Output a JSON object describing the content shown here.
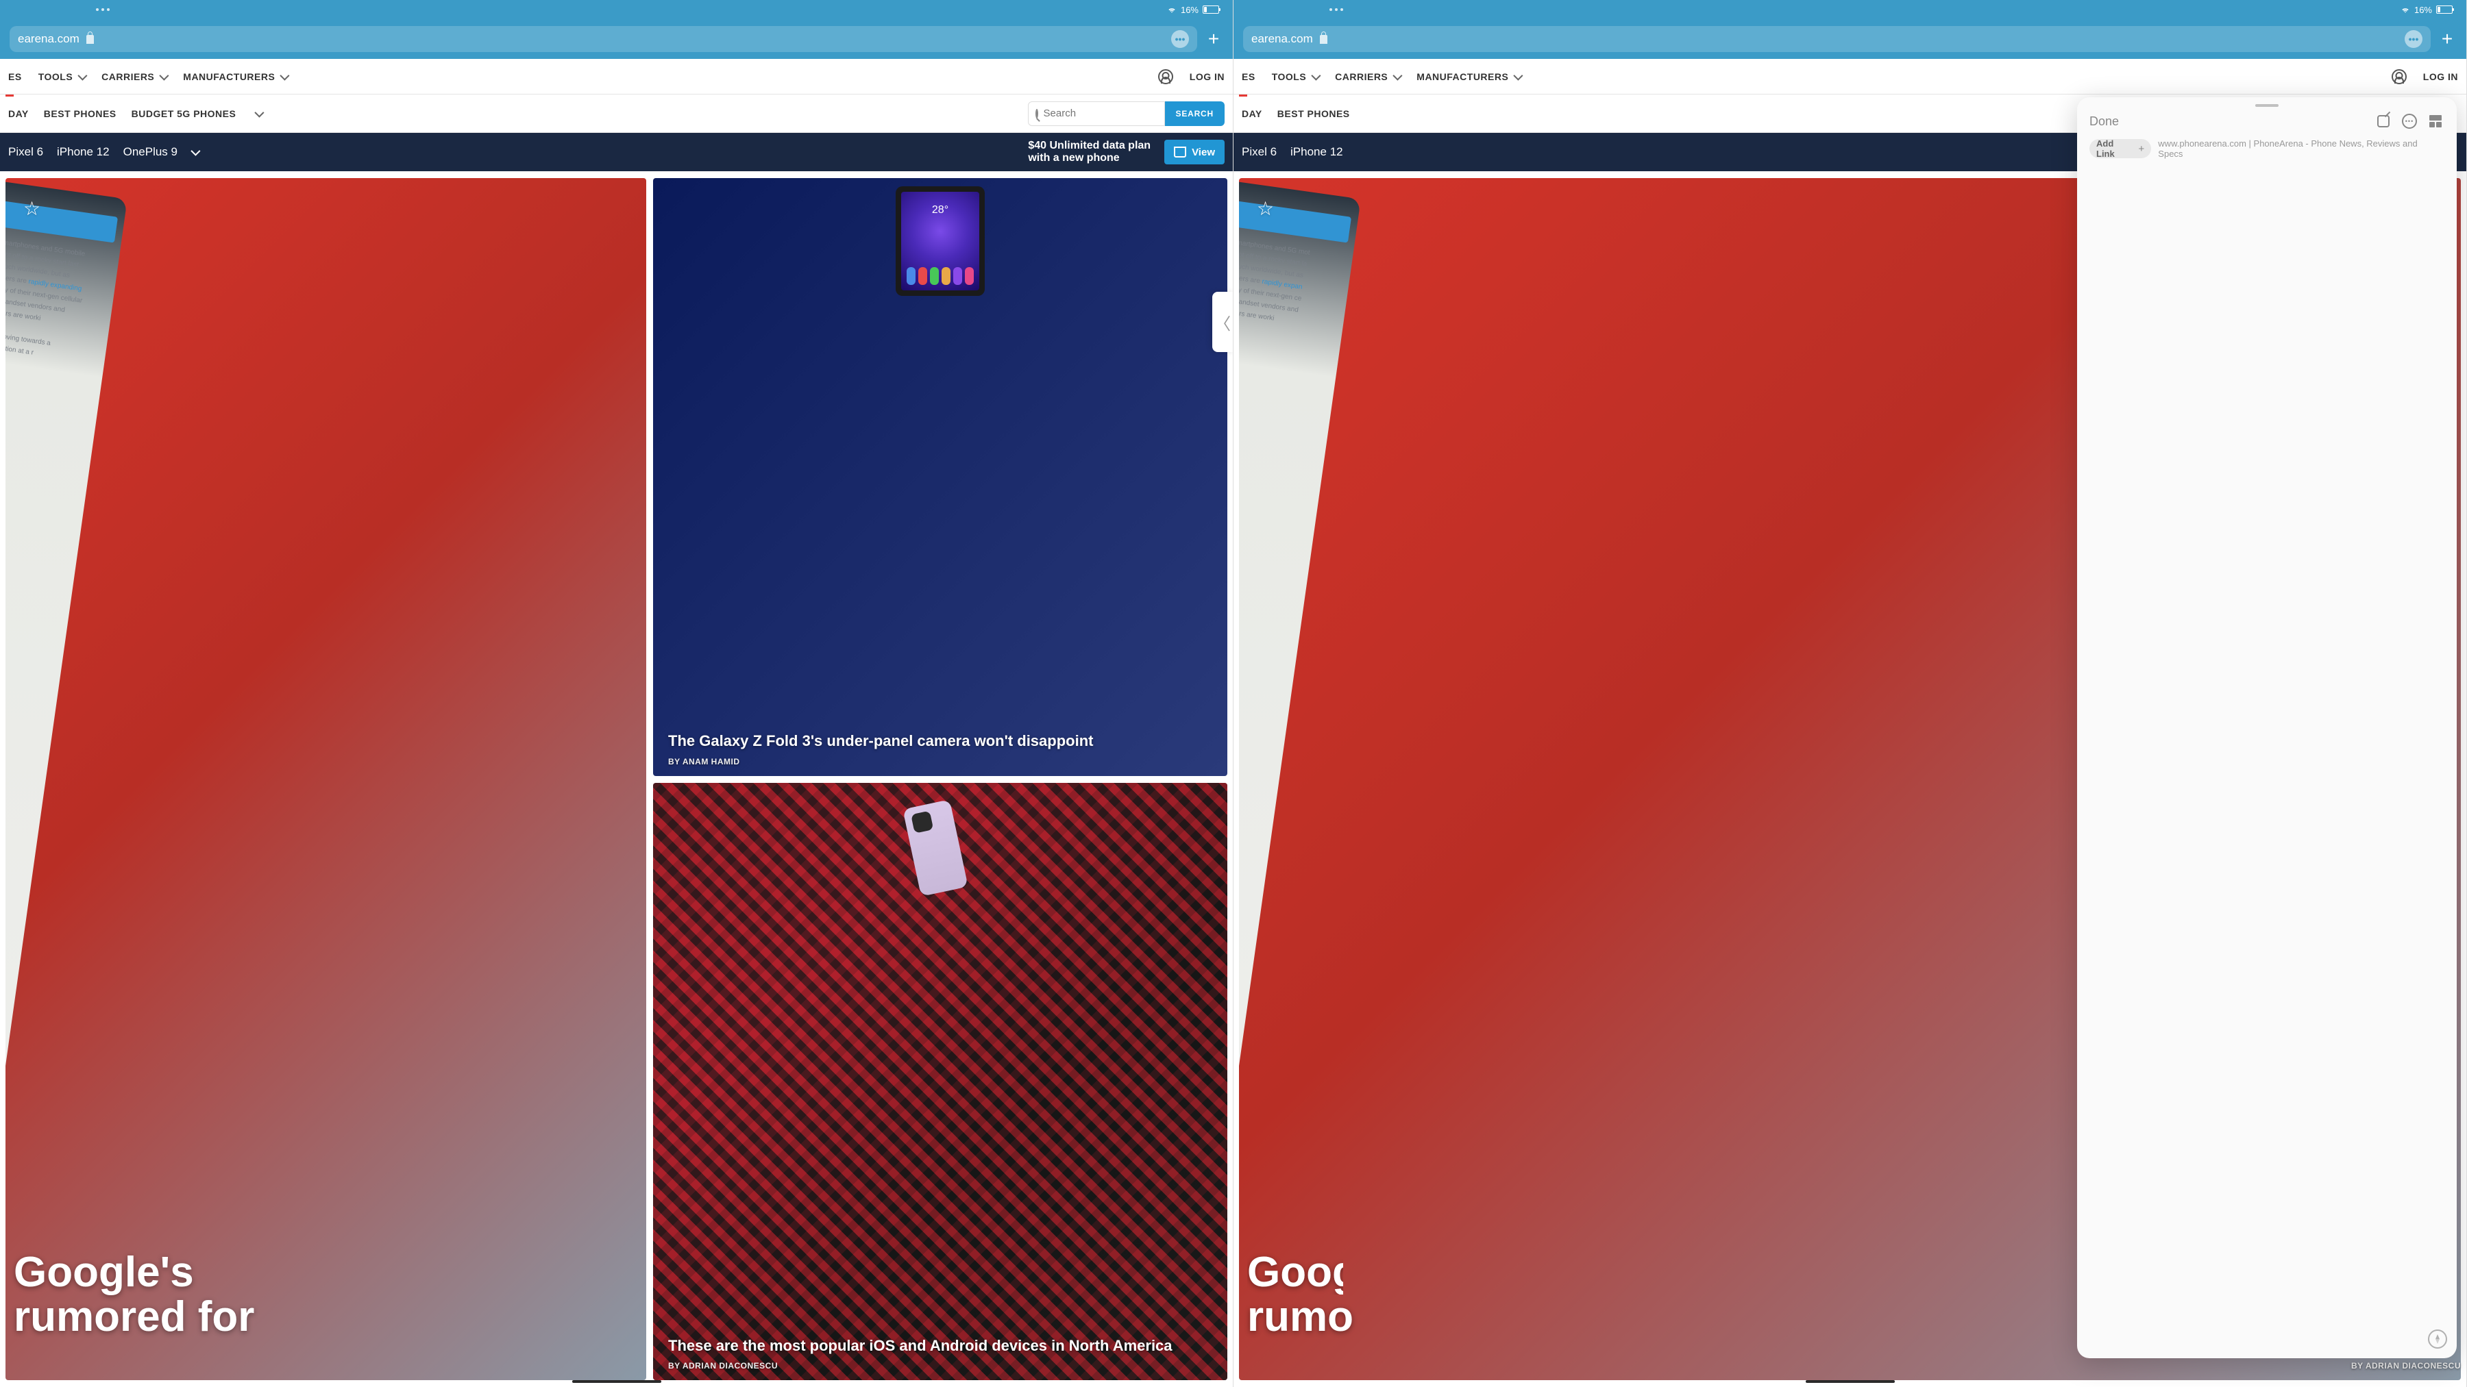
{
  "status": {
    "battery_pct": "16%"
  },
  "browser": {
    "url_fragment": "earena.com"
  },
  "nav": {
    "es": "ES",
    "tools": "TOOLS",
    "carriers": "CARRIERS",
    "manufacturers": "MANUFACTURERS",
    "login": "LOG IN"
  },
  "subnav": {
    "day": "DAY",
    "best_phones": "BEST PHONES",
    "budget_5g": "BUDGET 5G PHONES"
  },
  "search": {
    "placeholder": "Search",
    "button": "SEARCH"
  },
  "promo": {
    "pixel": "Pixel 6",
    "iphone": "iPhone 12",
    "oneplus": "OnePlus 9",
    "deal_line1": "$40 Unlimited data plan",
    "deal_line2": "with a new phone",
    "view": "View"
  },
  "hero": {
    "title_line1": "Google's",
    "title_line2": "rumored for",
    "title_line2_trunc": "rumo",
    "phone_time": "28°"
  },
  "card1": {
    "title": "The Galaxy Z Fold 3's under-panel camera won't disappoint",
    "author": "BY ANAM HAMID"
  },
  "card2": {
    "title": "These are the most popular iOS and Android devices in North America",
    "author": "BY ADRIAN DIACONESCU"
  },
  "note": {
    "done": "Done",
    "add_link": "Add Link",
    "url_text": "www.phonearena.com | PhoneArena - Phone News, Reviews and Specs"
  }
}
